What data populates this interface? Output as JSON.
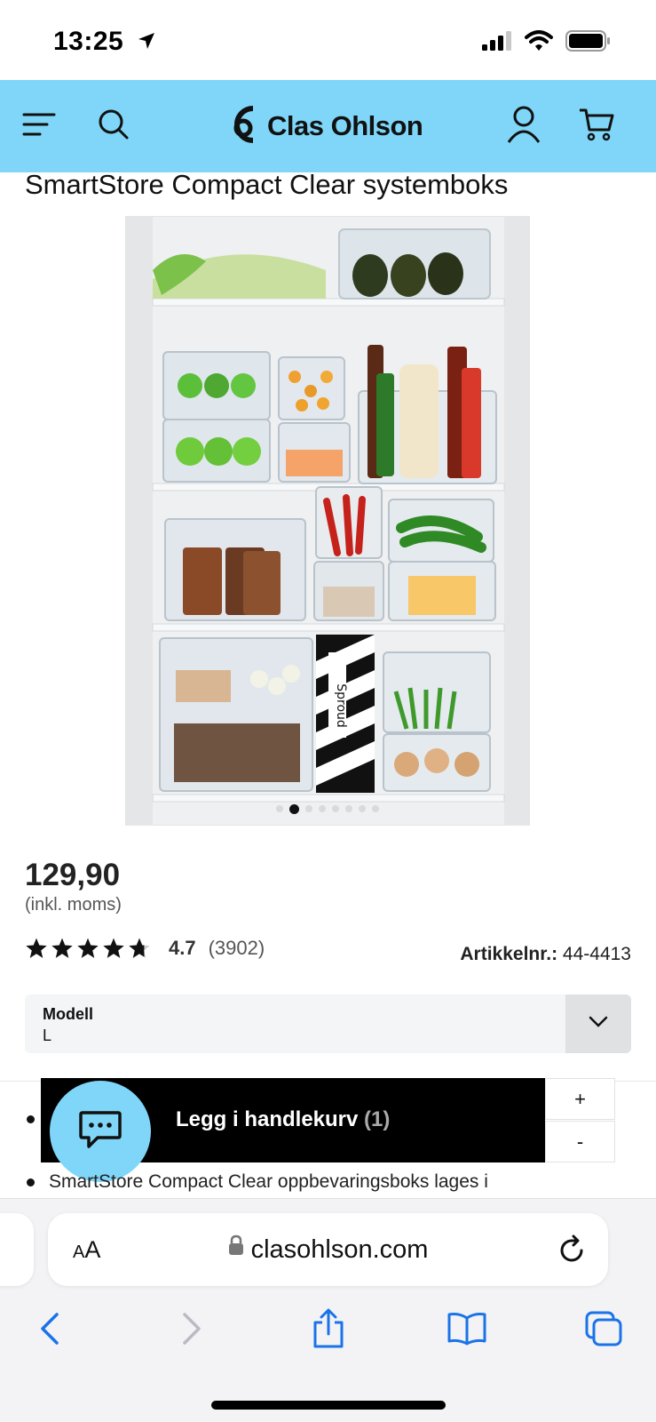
{
  "status_bar": {
    "time": "13:25"
  },
  "header": {
    "logo_text": "Clas Ohlson",
    "brand_color": "#7fd6f8",
    "icons": [
      "menu-icon",
      "search-icon",
      "user-icon",
      "cart-icon"
    ]
  },
  "product": {
    "title": "SmartStore Compact Clear systemboks",
    "price": "129,90",
    "vat_note": "(inkl. moms)",
    "rating": {
      "stars": 4.7,
      "value": "4.7",
      "count": "(3902)"
    },
    "article_label": "Artikkelnr.:",
    "article_number": "44-4413",
    "image": {
      "carton_text": "Sproud",
      "carousel": {
        "total": 8,
        "active": 1
      }
    }
  },
  "model_select": {
    "label": "Modell",
    "value": "L"
  },
  "cart": {
    "button_label": "Legg i handlekurv",
    "quantity": "(1)",
    "plus": "+",
    "minus": "-"
  },
  "description": {
    "items": [
      "SmartStore Compact Clear oppbevaringsboks lages i"
    ]
  },
  "safari": {
    "text_size": "AA",
    "url": "clasohlson.com"
  }
}
